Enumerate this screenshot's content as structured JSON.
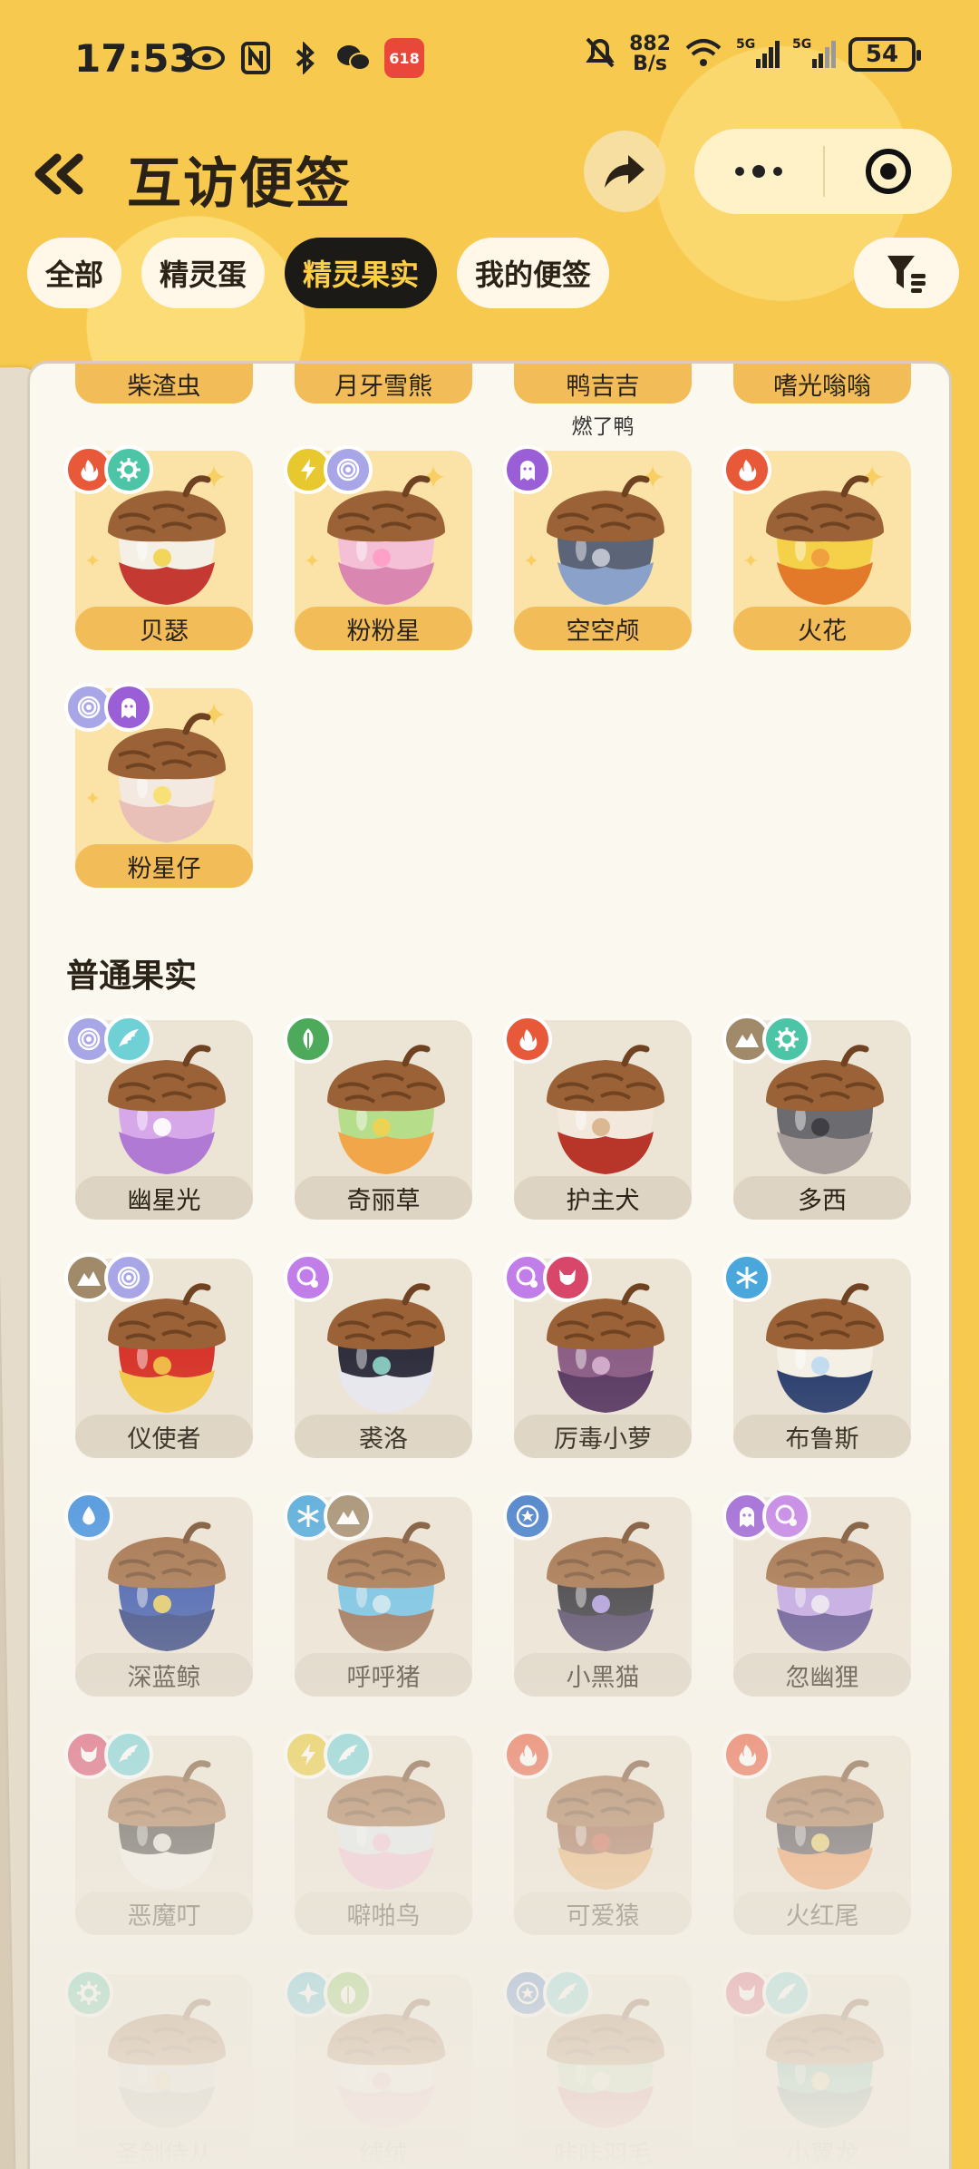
{
  "status": {
    "time": "17:53",
    "net_speed_value": "882",
    "net_speed_unit": "B/s",
    "battery": "54",
    "app_badge": "618"
  },
  "header": {
    "title": "互访便签"
  },
  "tabs": [
    {
      "label": "全部",
      "active": false
    },
    {
      "label": "精灵蛋",
      "active": false
    },
    {
      "label": "精灵果实",
      "active": true
    },
    {
      "label": "我的便签",
      "active": false
    }
  ],
  "top_row": {
    "labels": [
      "柴渣虫",
      "月牙雪熊",
      "鸭吉吉",
      "嗜光嗡嗡"
    ],
    "sub_label": "燃了鸭"
  },
  "special_fruits": [
    {
      "name": "贝瑟",
      "badges": [
        "fire",
        "gear"
      ],
      "colors": [
        "#f5f0e6",
        "#c43a32"
      ],
      "accent": "#f2d34b"
    },
    {
      "name": "粉粉星",
      "badges": [
        "lightning",
        "swirl"
      ],
      "colors": [
        "#f3c0d6",
        "#d987b0"
      ],
      "accent": "#ff9cc5"
    },
    {
      "name": "空空颅",
      "badges": [
        "ghost"
      ],
      "colors": [
        "#5c6577",
        "#8aa2c9"
      ],
      "accent": "#c8cbd6"
    },
    {
      "name": "火花",
      "badges": [
        "fire"
      ],
      "colors": [
        "#f5d14a",
        "#e37a2a"
      ],
      "accent": "#f09a3d"
    },
    {
      "name": "粉星仔",
      "badges": [
        "swirl",
        "ghost"
      ],
      "colors": [
        "#f3e9e1",
        "#e8c0b8"
      ],
      "accent": "#f7df6a"
    }
  ],
  "section_title": "普通果实",
  "normal_fruits": [
    {
      "name": "幽星光",
      "badges": [
        "swirl",
        "wing"
      ],
      "colors": [
        "#d6a8ea",
        "#b079d3"
      ],
      "accent": "#ffffff"
    },
    {
      "name": "奇丽草",
      "badges": [
        "leaf"
      ],
      "colors": [
        "#b5dd8a",
        "#f1a64a"
      ],
      "accent": "#f2d24d"
    },
    {
      "name": "护主犬",
      "badges": [
        "fire"
      ],
      "colors": [
        "#f2e8dc",
        "#b8352a"
      ],
      "accent": "#d9b28a"
    },
    {
      "name": "多西",
      "badges": [
        "mountain",
        "gear"
      ],
      "colors": [
        "#6b6b70",
        "#a59c99"
      ],
      "accent": "#3b3b40"
    },
    {
      "name": "仪使者",
      "badges": [
        "mountain",
        "swirl"
      ],
      "colors": [
        "#d7362c",
        "#f2c84a"
      ],
      "accent": "#f2c84a"
    },
    {
      "name": "裘洛",
      "badges": [
        "bubble"
      ],
      "colors": [
        "#2f2f3e",
        "#e7e7ef"
      ],
      "accent": "#8fd6c8"
    },
    {
      "name": "厉毒小萝",
      "badges": [
        "bubble",
        "demon"
      ],
      "colors": [
        "#8c5f86",
        "#5a3a63"
      ],
      "accent": "#d7b3d0"
    },
    {
      "name": "布鲁斯",
      "badges": [
        "snow"
      ],
      "colors": [
        "#f4f0e6",
        "#2c3f6e"
      ],
      "accent": "#bcd9ef"
    },
    {
      "name": "深蓝鲸",
      "badges": [
        "water"
      ],
      "colors": [
        "#2747a6",
        "#1a2d74"
      ],
      "accent": "#f4d14a"
    },
    {
      "name": "呼呼猪",
      "badges": [
        "snow",
        "mountain"
      ],
      "colors": [
        "#5dbbe6",
        "#8c5a3a"
      ],
      "accent": "#c7e8f5"
    },
    {
      "name": "小黑猫",
      "badges": [
        "star"
      ],
      "colors": [
        "#1d1c24",
        "#3a2f57"
      ],
      "accent": "#b39cf0"
    },
    {
      "name": "忽幽狸",
      "badges": [
        "ghost",
        "bubble"
      ],
      "colors": [
        "#b99ae6",
        "#4a3a86"
      ],
      "accent": "#f1eaf8"
    },
    {
      "name": "恶魔叮",
      "badges": [
        "demon",
        "wing"
      ],
      "colors": [
        "#2a2626",
        "#f2efe9"
      ],
      "accent": "#f2efe9"
    },
    {
      "name": "噼啪鸟",
      "badges": [
        "lightning",
        "wing"
      ],
      "colors": [
        "#dfe7ef",
        "#f2b9d0"
      ],
      "accent": "#f2b9d0"
    },
    {
      "name": "可爱猿",
      "badges": [
        "fire"
      ],
      "colors": [
        "#8d4a2c",
        "#e4a35a"
      ],
      "accent": "#c7492f"
    },
    {
      "name": "火红尾",
      "badges": [
        "fire"
      ],
      "colors": [
        "#2b2430",
        "#e9823a"
      ],
      "accent": "#f2d04c"
    },
    {
      "name": "圣剑侍从",
      "badges": [
        "gear"
      ],
      "colors": [
        "#d9d8d6",
        "#9a9894"
      ],
      "accent": "#e4c98a"
    },
    {
      "name": "绒绒",
      "badges": [
        "sparkle",
        "bug"
      ],
      "colors": [
        "#f1eef2",
        "#f2a6c8"
      ],
      "accent": "#f2a6c8"
    },
    {
      "name": "咔咔羽毛",
      "badges": [
        "star",
        "wing"
      ],
      "colors": [
        "#a9d8a8",
        "#d0476a"
      ],
      "accent": "#f2efe9"
    },
    {
      "name": "小翼龙",
      "badges": [
        "demon",
        "wing"
      ],
      "colors": [
        "#3ea59a",
        "#1f5b5c"
      ],
      "accent": "#f2cf8a"
    }
  ],
  "badge_colors": {
    "fire": "#e8593a",
    "gear": "#4cc4a6",
    "lightning": "#e8c82f",
    "swirl": "#a9a6e8",
    "ghost": "#9a5fd6",
    "wing": "#6fd0d6",
    "leaf": "#4caa5a",
    "mountain": "#a08a6a",
    "bubble": "#c27ee8",
    "demon": "#d8476a",
    "snow": "#4aa7dc",
    "water": "#3e8ee0",
    "star": "#3a77c9",
    "sparkle": "#3bb7d9",
    "bug": "#7cc24a"
  }
}
